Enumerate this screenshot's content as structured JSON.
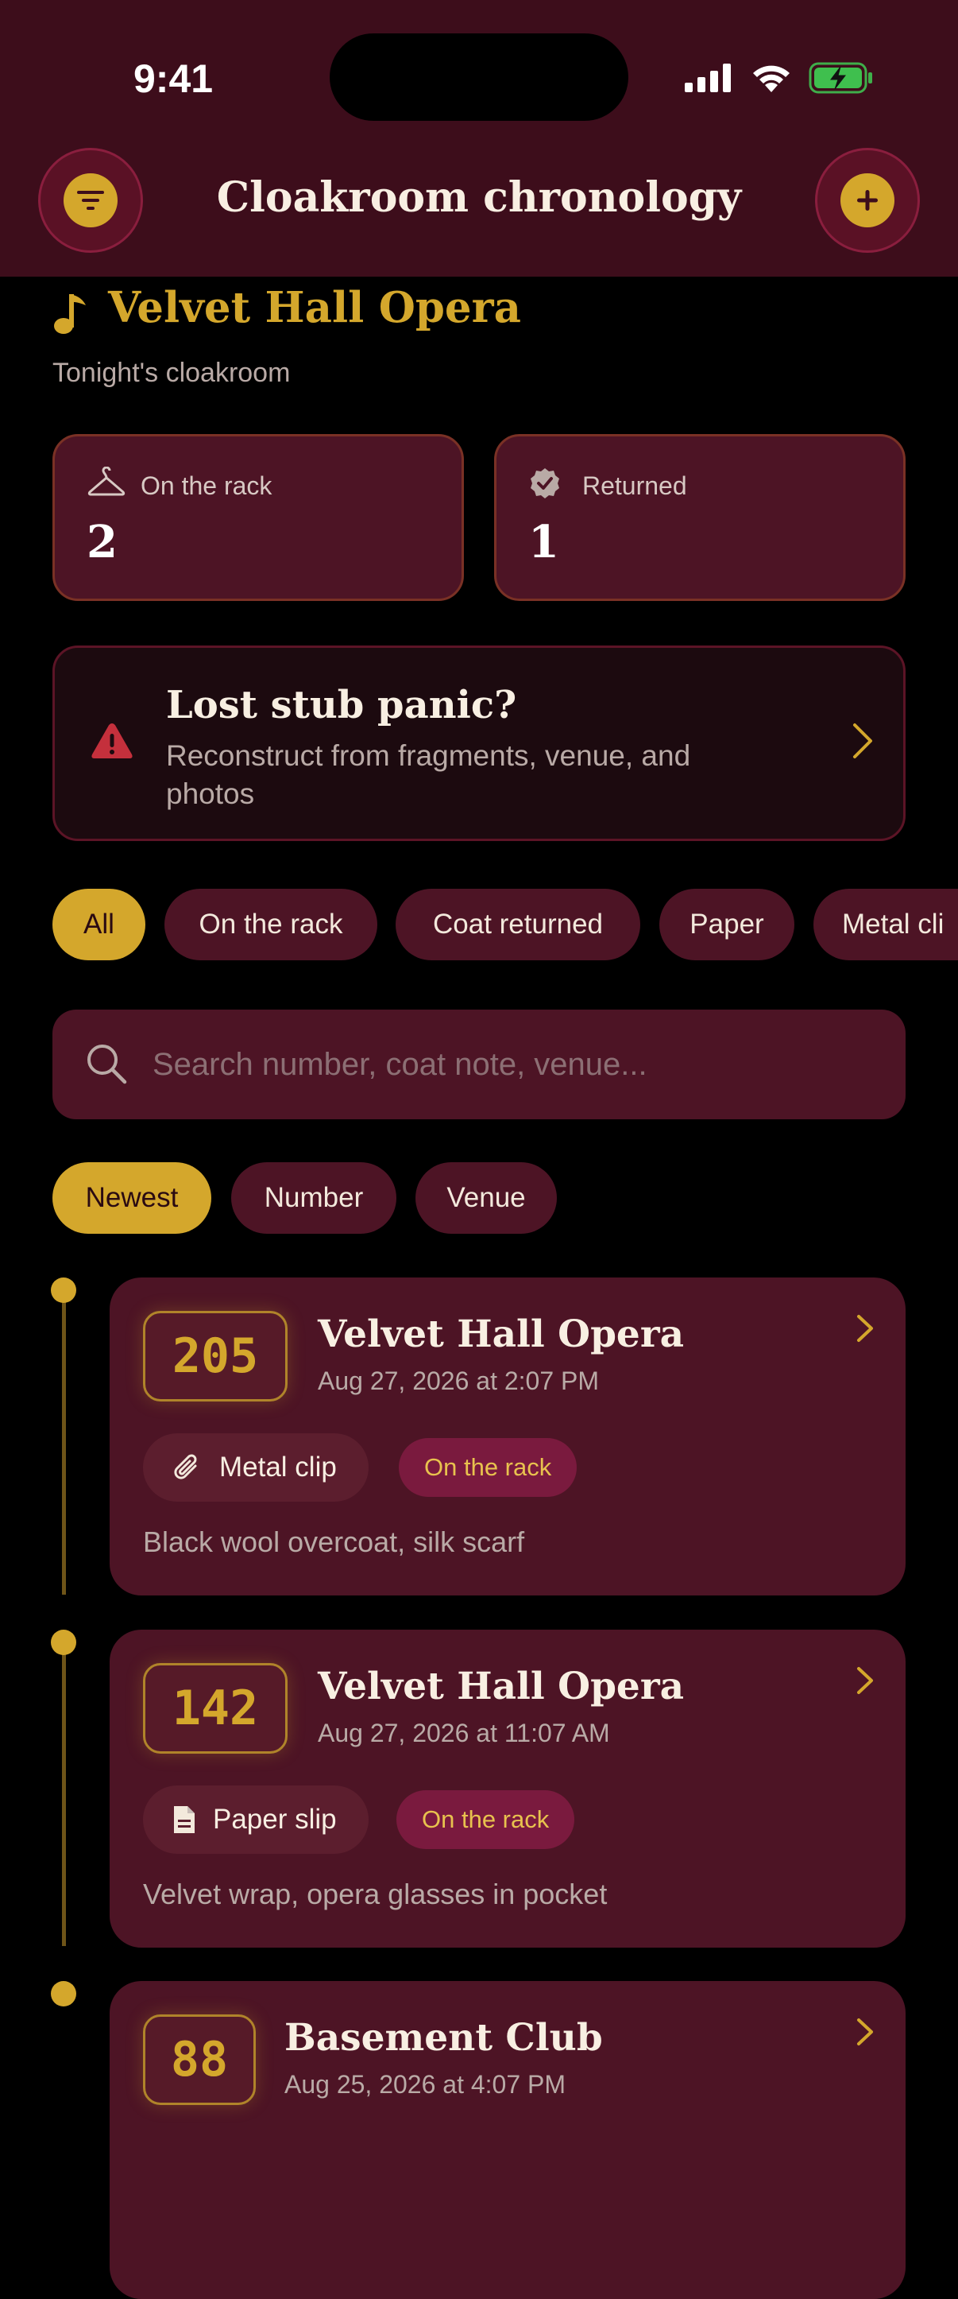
{
  "status_bar": {
    "time": "9:41"
  },
  "header": {
    "title": "Cloakroom chronology",
    "filter_icon": "filter-icon",
    "add_icon": "plus-icon"
  },
  "venue": {
    "title": "Velvet Hall Opera",
    "subtitle": "Tonight's cloakroom",
    "icon": "music-note-icon"
  },
  "stats": [
    {
      "label": "On the rack",
      "value": "2",
      "icon": "hanger-icon"
    },
    {
      "label": "Returned",
      "value": "1",
      "icon": "verified-badge-icon"
    }
  ],
  "lost_stub": {
    "title": "Lost stub panic?",
    "description": "Reconstruct from fragments, venue, and photos",
    "icon": "warning-icon"
  },
  "filters": [
    "All",
    "On the rack",
    "Coat returned",
    "Paper",
    "Metal cli"
  ],
  "search": {
    "placeholder": "Search number, coat note, venue..."
  },
  "sorts": [
    "Newest",
    "Number",
    "Venue"
  ],
  "tickets": [
    {
      "number": "205",
      "venue": "Velvet Hall Opera",
      "date": "Aug 27, 2026 at 2:07 PM",
      "type": "Metal clip",
      "type_icon": "paperclip-icon",
      "status": "On the rack",
      "note": "Black wool overcoat, silk scarf"
    },
    {
      "number": "142",
      "venue": "Velvet Hall Opera",
      "date": "Aug 27, 2026 at 11:07 AM",
      "type": "Paper slip",
      "type_icon": "document-icon",
      "status": "On the rack",
      "note": "Velvet wrap, opera glasses in pocket"
    },
    {
      "number": "88",
      "venue": "Basement Club",
      "date": "Aug 25, 2026 at 4:07 PM"
    }
  ],
  "colors": {
    "accent": "#d4a72c",
    "header_bg": "#3d0d1b",
    "card_bg": "#4d1425",
    "status_pill": "#7a1a3e"
  }
}
